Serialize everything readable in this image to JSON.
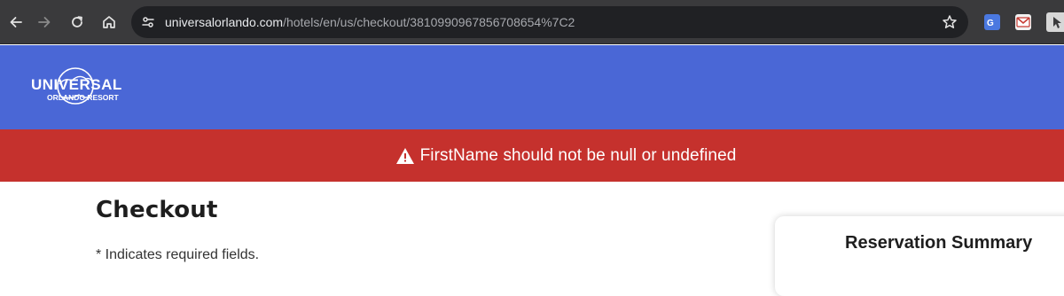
{
  "browser": {
    "url_host": "universalorlando.com",
    "url_path": "/hotels/en/us/checkout/3810990967856708654%7C2"
  },
  "logo": {
    "line1": "UNIVERSAL",
    "line2": "ORLANDO RESORT"
  },
  "error_banner": {
    "message": "FirstName should not be null or undefined"
  },
  "checkout": {
    "title": "Checkout",
    "required_note": "* Indicates required fields."
  },
  "summary": {
    "title": "Reservation Summary"
  },
  "colors": {
    "browser_bar": "#3a3a3c",
    "header_blue": "#4a67d6",
    "error_red": "#c5312d"
  }
}
